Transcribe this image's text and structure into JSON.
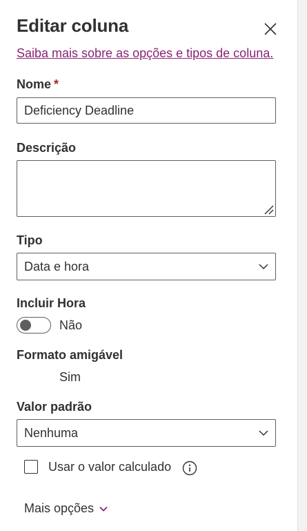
{
  "panel": {
    "title": "Editar coluna",
    "learn_more_link": "Saiba mais sobre as opções e tipos de coluna."
  },
  "name_field": {
    "label": "Nome",
    "required_marker": "*",
    "value": "Deficiency Deadline"
  },
  "description_field": {
    "label": "Descrição",
    "value": ""
  },
  "type_field": {
    "label": "Tipo",
    "selected": "Data e hora"
  },
  "include_time": {
    "label": "Incluir Hora",
    "state_text": "Não",
    "on": false
  },
  "friendly_format": {
    "label": "Formato amigável",
    "value_text": "Sim"
  },
  "default_value": {
    "label": "Valor padrão",
    "selected": "Nenhuma"
  },
  "calculated_checkbox": {
    "label": "Usar o valor calculado",
    "checked": false
  },
  "more_options": {
    "label": "Mais opções"
  },
  "icons": {
    "close": "close-icon",
    "chevron": "chevron-down-icon",
    "info": "info-icon",
    "resize": "resize-grip-icon"
  },
  "colors": {
    "link": "#8a2374",
    "required": "#a4262c",
    "border": "#605e5c",
    "text": "#323130"
  }
}
